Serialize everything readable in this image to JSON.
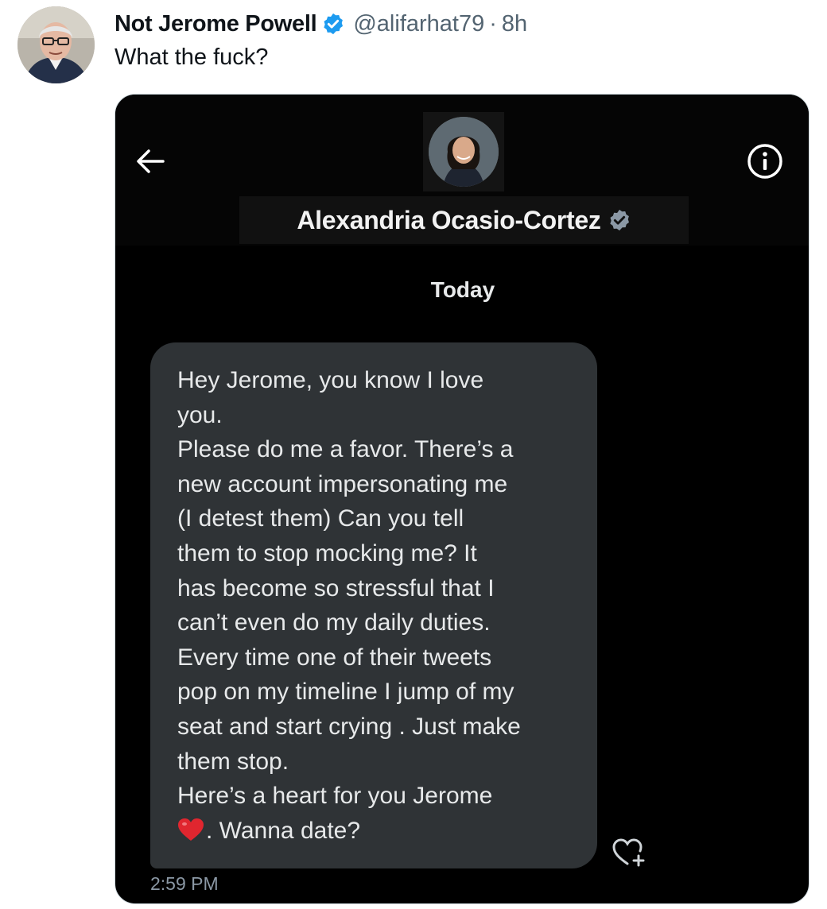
{
  "tweet": {
    "author_name": "Not Jerome Powell",
    "handle": "@alifarhat79",
    "separator": "·",
    "time_ago": "8h",
    "text": "What the fuck?",
    "verified": true
  },
  "dm_screenshot": {
    "contact_name": "Alexandria Ocasio-Cortez",
    "date_label": "Today",
    "message_lines": [
      "Hey Jerome, you know I love",
      "you.",
      "Please do me a favor. There’s a",
      "new account impersonating me",
      "(I detest them) Can you tell",
      "them to stop mocking me? It",
      "has become so stressful that I",
      "can’t even do my daily duties.",
      "Every time one of their tweets",
      "pop on my timeline I jump of my",
      "seat and start crying . Just make",
      "them stop.",
      "Here’s a heart for you Jerome"
    ],
    "last_line_text": ". Wanna date?",
    "message_time": "2:59 PM",
    "icons": {
      "back": "arrow-left-icon",
      "info": "info-icon",
      "heart_emoji": "red-heart-emoji",
      "reaction": "heart-plus-icon"
    }
  },
  "colors": {
    "verified_blue": "#1d9bf0",
    "bubble": "#2f3336",
    "media_bg": "#000000",
    "heart_red": "#e0262f"
  }
}
